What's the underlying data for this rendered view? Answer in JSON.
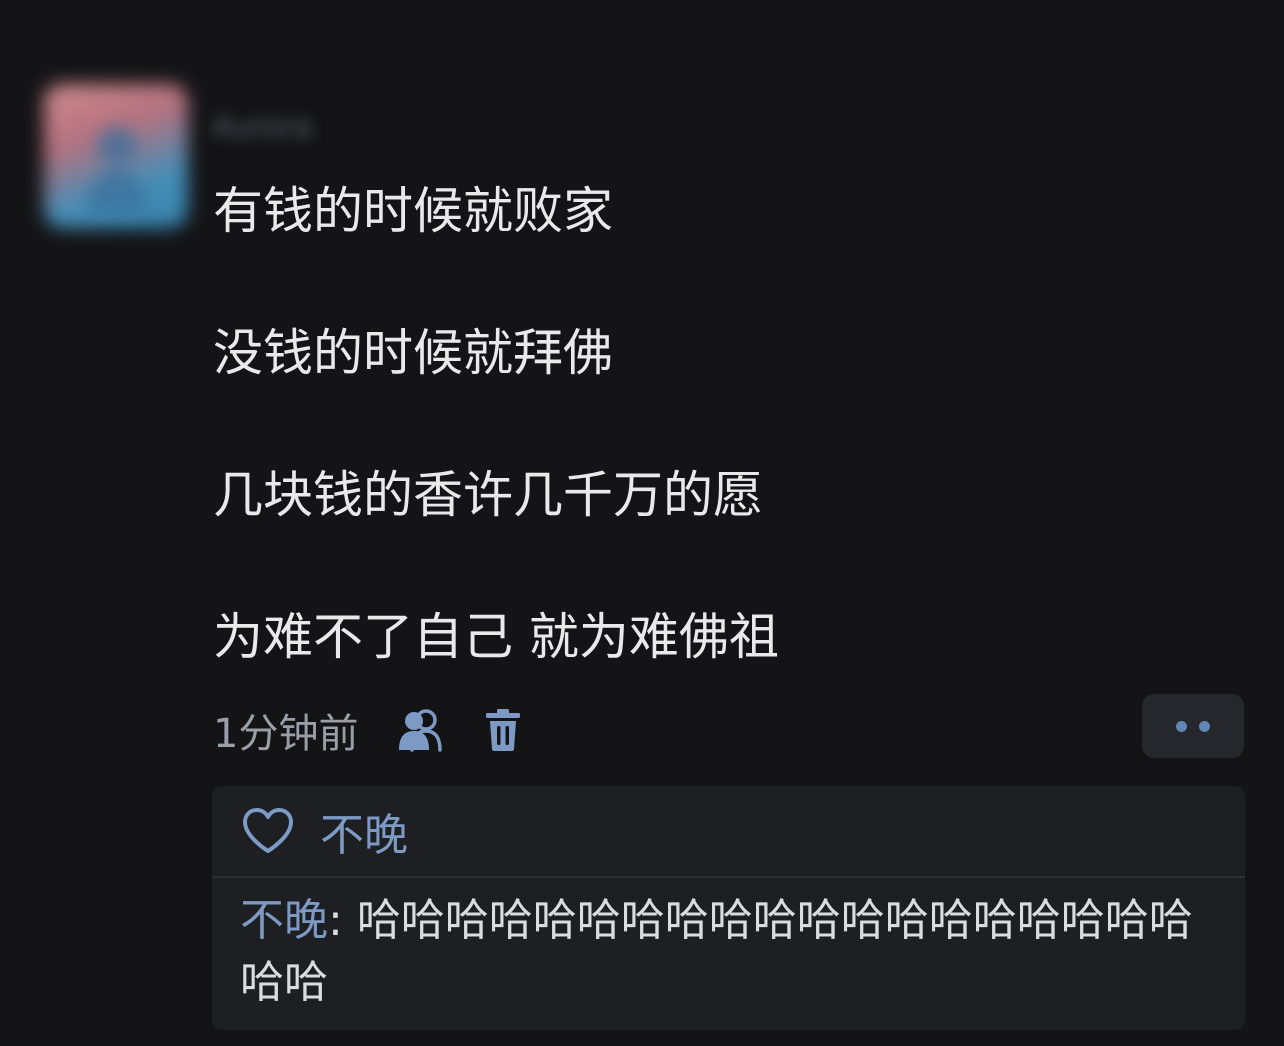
{
  "post": {
    "username": "Aurora",
    "lines": [
      "有钱的时候就败家",
      "没钱的时候就拜佛",
      "几块钱的香许几千万的愿",
      "为难不了自己 就为难佛祖"
    ],
    "time": "1分钟前",
    "icons": {
      "visibility": "friends-icon",
      "delete": "trash-icon",
      "more": "more-dots-icon"
    }
  },
  "interactions": {
    "like_icon": "heart-outline-icon",
    "liker": "不晚",
    "reply": {
      "user": "不晚",
      "colon": ": ",
      "text": "哈哈哈哈哈哈哈哈哈哈哈哈哈哈哈哈哈哈哈哈哈"
    }
  },
  "colors": {
    "background": "#141416",
    "accent": "#7d9ac4",
    "text": "#e9e9ea",
    "muted": "#9a9ea6"
  }
}
